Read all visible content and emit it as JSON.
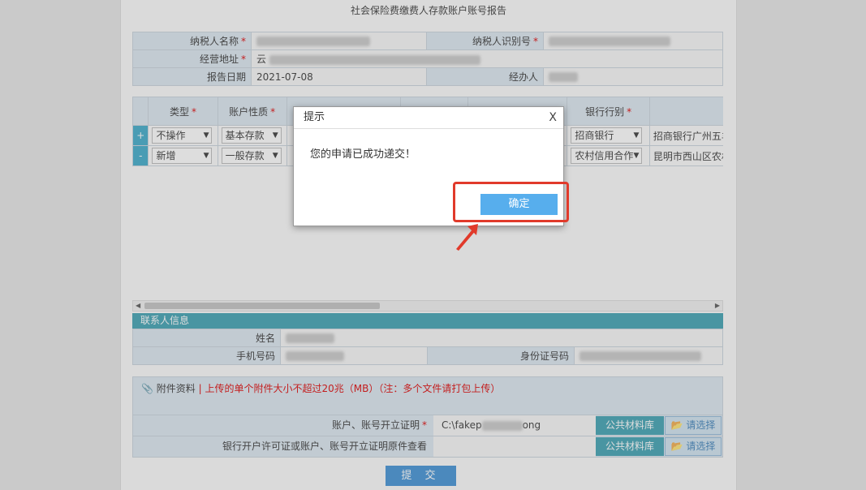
{
  "form": {
    "title": "社会保险费缴费人存款账户账号报告",
    "taxpayer_name_label": "纳税人名称",
    "taxpayer_id_label": "纳税人识别号",
    "address_label": "经营地址",
    "address_prefix": "云",
    "report_date_label": "报告日期",
    "report_date": "2021-07-08",
    "handler_label": "经办人",
    "required_mark": "*"
  },
  "accounts": {
    "headers": {
      "type": "类型",
      "nature": "账户性质",
      "bank_type": "银行行别"
    },
    "rows": [
      {
        "pm": "+",
        "type": "不操作",
        "nature": "基本存款",
        "bank": "招商银行",
        "branch": "招商银行广州五羊"
      },
      {
        "pm": "-",
        "type": "新增",
        "nature": "一般存款",
        "bank": "农村信用合作",
        "branch": "昆明市西山区农村"
      }
    ]
  },
  "contact": {
    "section_title": "联系人信息",
    "name_label": "姓名",
    "phone_label": "手机号码",
    "id_label": "身份证号码"
  },
  "attachments": {
    "title": "附件资料",
    "warning": "| 上传的单个附件大小不超过20兆（MB）（注：多个文件请打包上传）",
    "rows": [
      {
        "label": "账户、账号开立证明",
        "required": true,
        "value_prefix": "C:\\fakep",
        "value_suffix": "ong",
        "lib": "公共材料库",
        "pick": "请选择"
      },
      {
        "label": "银行开户许可证或账户、账号开立证明原件查看",
        "required": false,
        "value_prefix": "",
        "value_suffix": "",
        "lib": "公共材料库",
        "pick": "请选择"
      }
    ]
  },
  "submit_label": "提 交",
  "dialog": {
    "title": "提示",
    "close": "X",
    "message": "您的申请已成功递交！",
    "ok": "确定"
  },
  "colors": {
    "accent": "#3a9fb1",
    "ok_button": "#57aeed",
    "highlight": "#e13a2b"
  }
}
